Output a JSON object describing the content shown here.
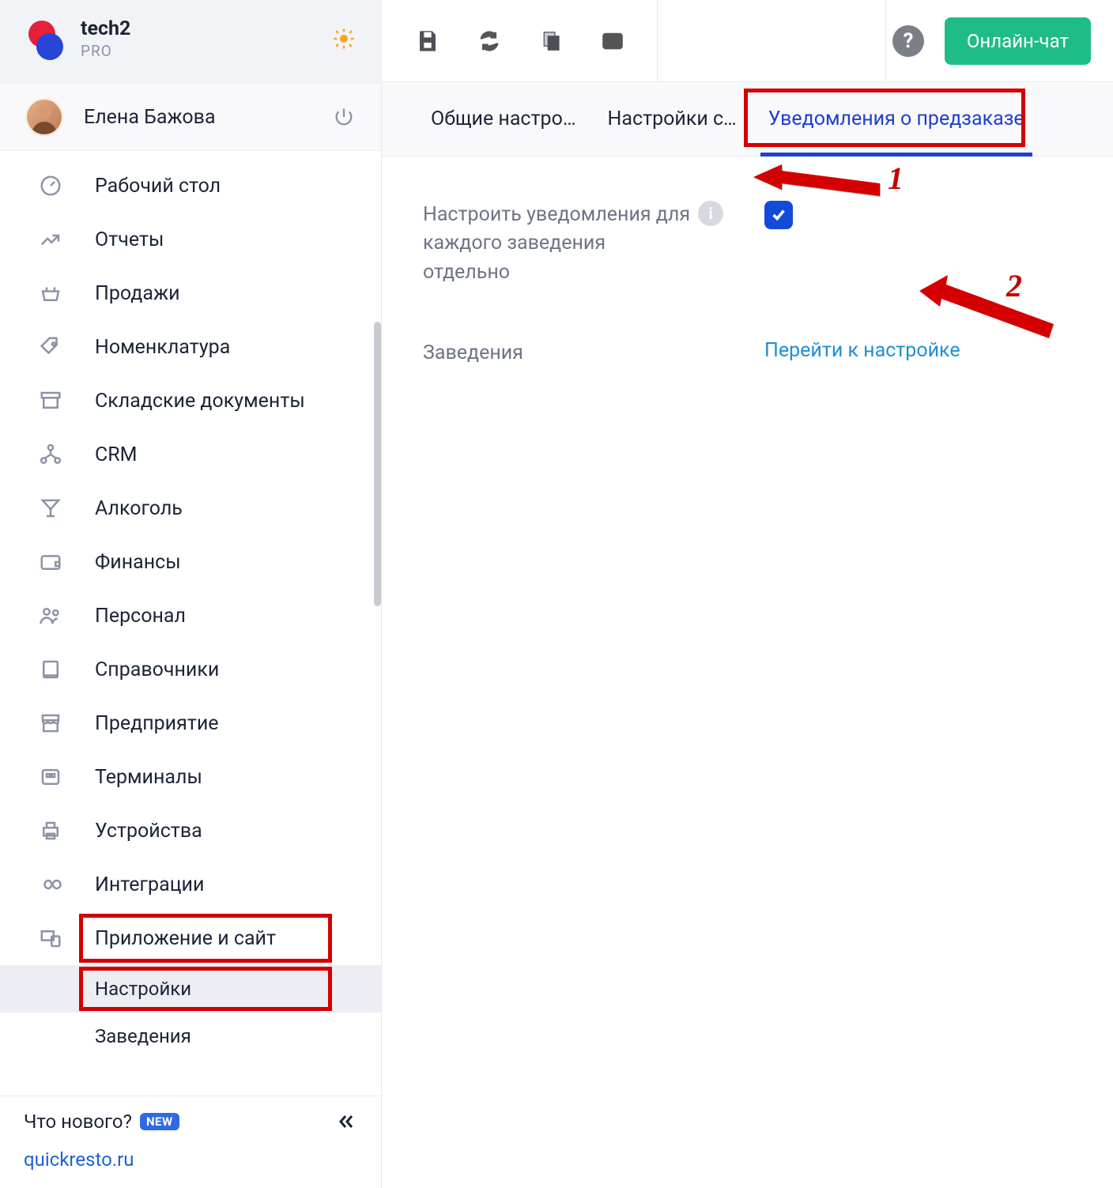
{
  "account": {
    "name": "tech2",
    "plan": "PRO"
  },
  "user": {
    "name": "Елена Бажова"
  },
  "nav": [
    {
      "icon": "gauge-icon",
      "label": "Рабочий стол"
    },
    {
      "icon": "chart-icon",
      "label": "Отчеты"
    },
    {
      "icon": "basket-icon",
      "label": "Продажи"
    },
    {
      "icon": "tag-icon",
      "label": "Номенклатура"
    },
    {
      "icon": "archive-icon",
      "label": "Складские документы"
    },
    {
      "icon": "org-icon",
      "label": "CRM"
    },
    {
      "icon": "cocktail-icon",
      "label": "Алкоголь"
    },
    {
      "icon": "wallet-icon",
      "label": "Финансы"
    },
    {
      "icon": "people-icon",
      "label": "Персонал"
    },
    {
      "icon": "book-icon",
      "label": "Справочники"
    },
    {
      "icon": "store-icon",
      "label": "Предприятие"
    },
    {
      "icon": "qr-icon",
      "label": "Терминалы"
    },
    {
      "icon": "printer-icon",
      "label": "Устройства"
    },
    {
      "icon": "infinity-icon",
      "label": "Интеграции"
    },
    {
      "icon": "app-icon",
      "label": "Приложение и сайт"
    }
  ],
  "subnav": {
    "settings": "Настройки",
    "venues": "Заведения"
  },
  "footer": {
    "whats_new": "Что нового?",
    "new_badge": "NEW",
    "site_link": "quickresto.ru"
  },
  "toolbar": {
    "help_label": "?",
    "chat_label": "Онлайн-чат"
  },
  "tabs": [
    {
      "label": "Общие настро…",
      "active": false
    },
    {
      "label": "Настройки с…",
      "active": false
    },
    {
      "label": "Уведомления о предзаказе",
      "active": true
    }
  ],
  "content": {
    "per_venue_label": "Настроить уведомления для каждого заведения отдельно",
    "per_venue_checked": true,
    "venues_label": "Заведения",
    "goto_link": "Перейти к настройке"
  },
  "annotations": {
    "n1": "1",
    "n2": "2"
  }
}
